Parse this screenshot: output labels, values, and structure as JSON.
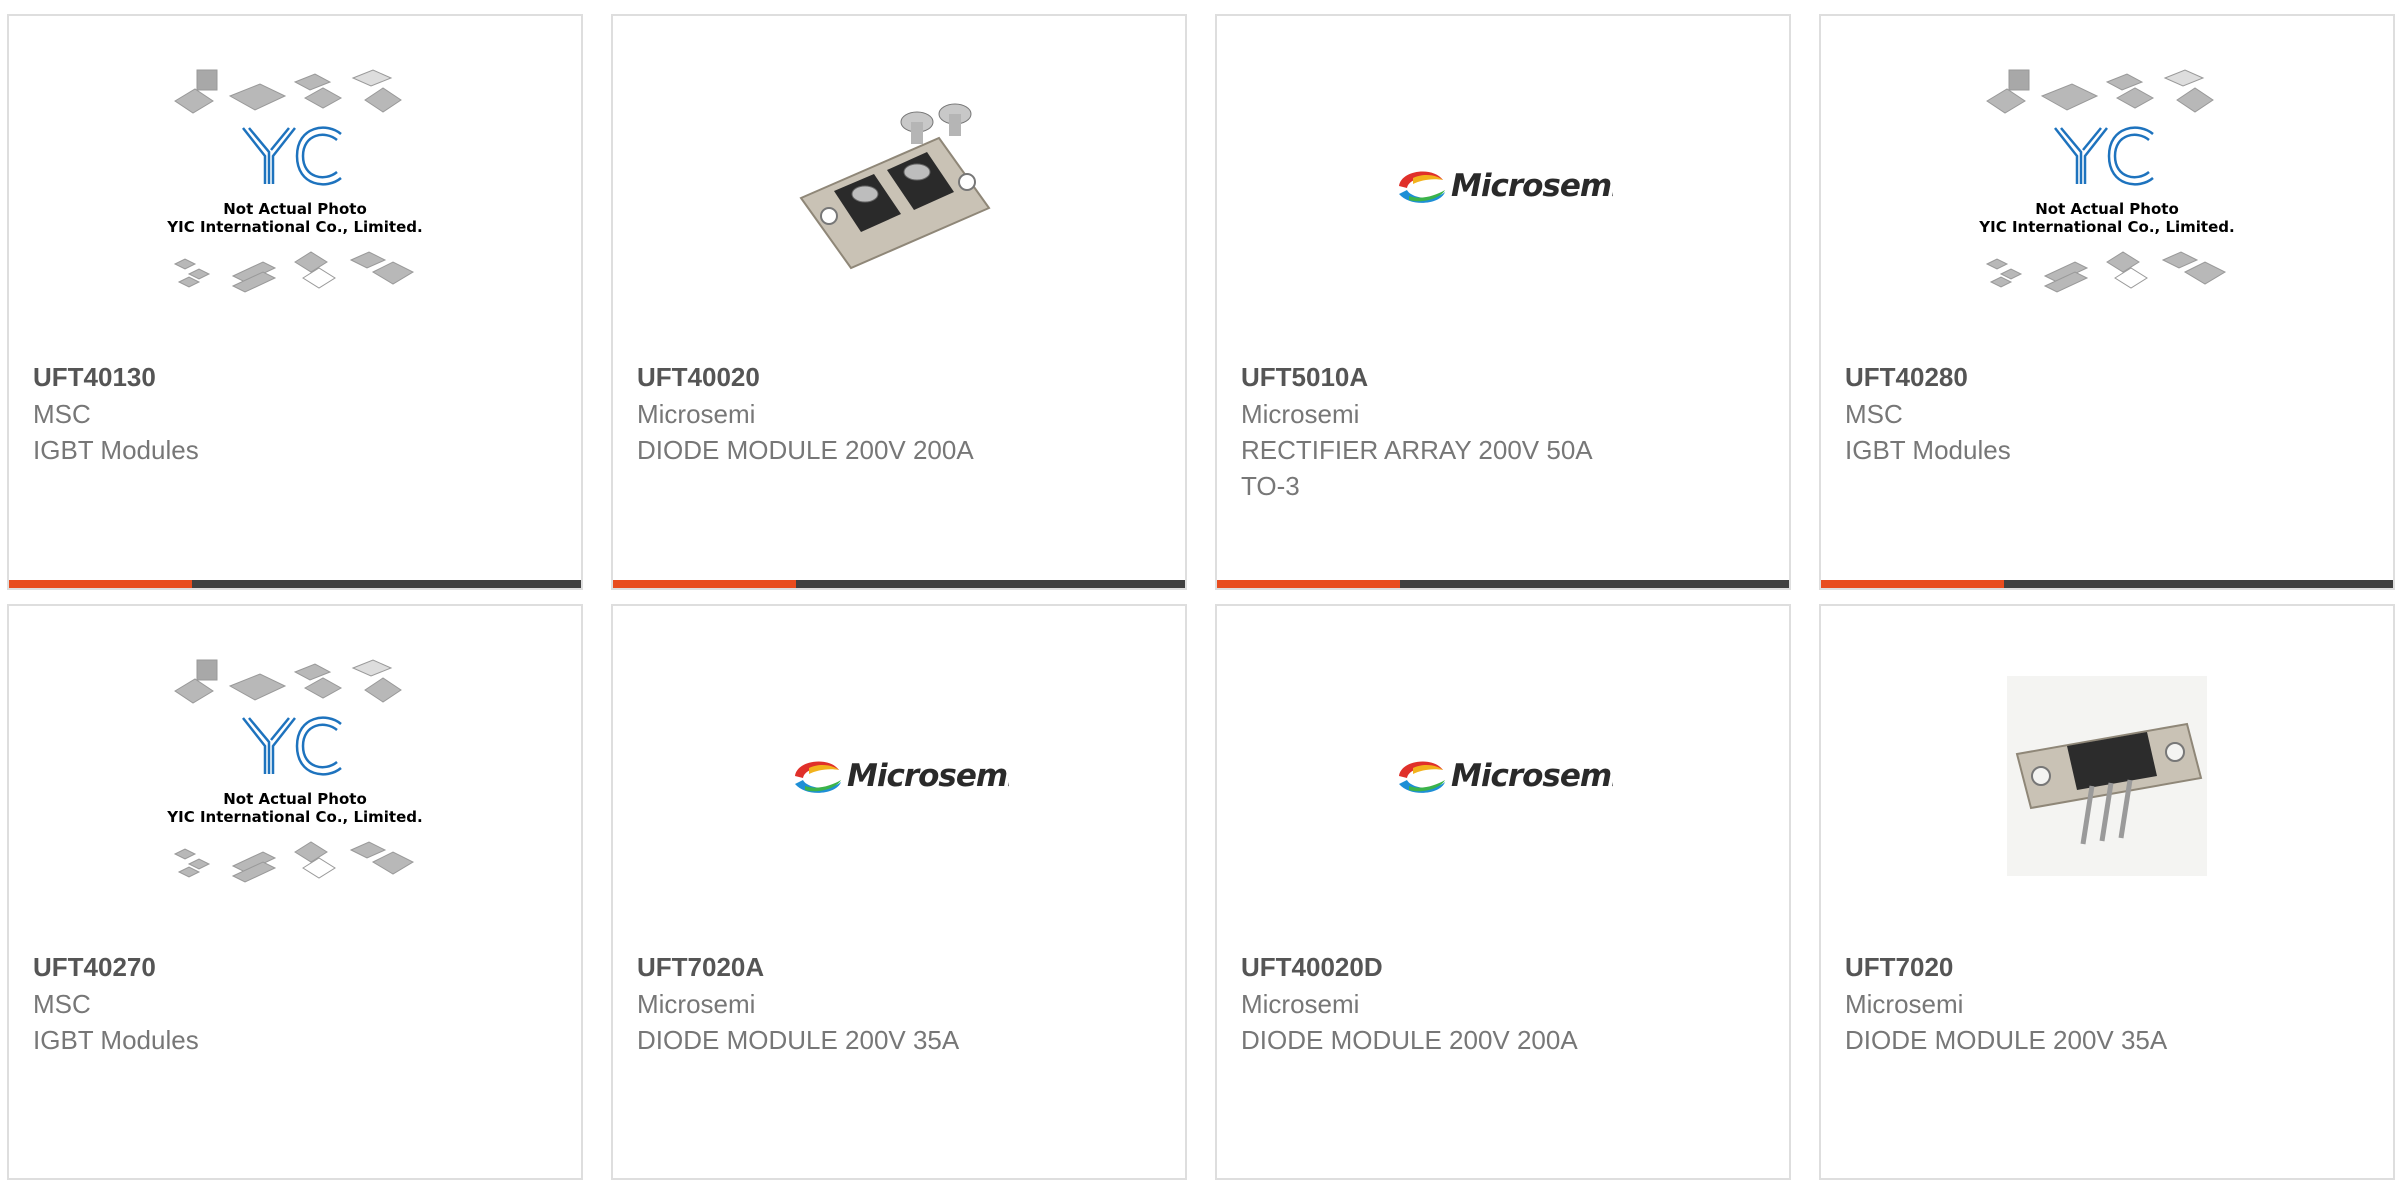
{
  "products": [
    {
      "part_number": "UFT40130",
      "manufacturer": "MSC",
      "description": "IGBT Modules",
      "image": "yic-placeholder-image",
      "image_caption": [
        "Not Actual Photo",
        "YIC International Co., Limited."
      ]
    },
    {
      "part_number": "UFT40020",
      "manufacturer": "Microsemi",
      "description": "DIODE MODULE 200V 200A",
      "image": "diode-module-photo"
    },
    {
      "part_number": "UFT5010A",
      "manufacturer": "Microsemi",
      "description": "RECTIFIER ARRAY 200V 50A\nTO-3",
      "image": "microsemi-logo",
      "logo_text": "Microsemi"
    },
    {
      "part_number": "UFT40280",
      "manufacturer": "MSC",
      "description": "IGBT Modules",
      "image": "yic-placeholder-image",
      "image_caption": [
        "Not Actual Photo",
        "YIC International Co., Limited."
      ]
    },
    {
      "part_number": "UFT40270",
      "manufacturer": "MSC",
      "description": "IGBT Modules",
      "image": "yic-placeholder-image",
      "image_caption": [
        "Not Actual Photo",
        "YIC International Co., Limited."
      ]
    },
    {
      "part_number": "UFT7020A",
      "manufacturer": "Microsemi",
      "description": "DIODE MODULE 200V 35A",
      "image": "microsemi-logo",
      "logo_text": "Microsemi"
    },
    {
      "part_number": "UFT40020D",
      "manufacturer": "Microsemi",
      "description": "DIODE MODULE 200V 200A",
      "image": "microsemi-logo",
      "logo_text": "Microsemi"
    },
    {
      "part_number": "UFT7020",
      "manufacturer": "Microsemi",
      "description": "DIODE MODULE 200V 35A",
      "image": "transistor-module-photo"
    }
  ],
  "colors": {
    "accent": "#e84c1e",
    "bar": "#404040",
    "card_border": "#dedede",
    "part_number_text": "#555555",
    "secondary_text": "#777777",
    "yic_logo_blue": "#1e73be"
  }
}
